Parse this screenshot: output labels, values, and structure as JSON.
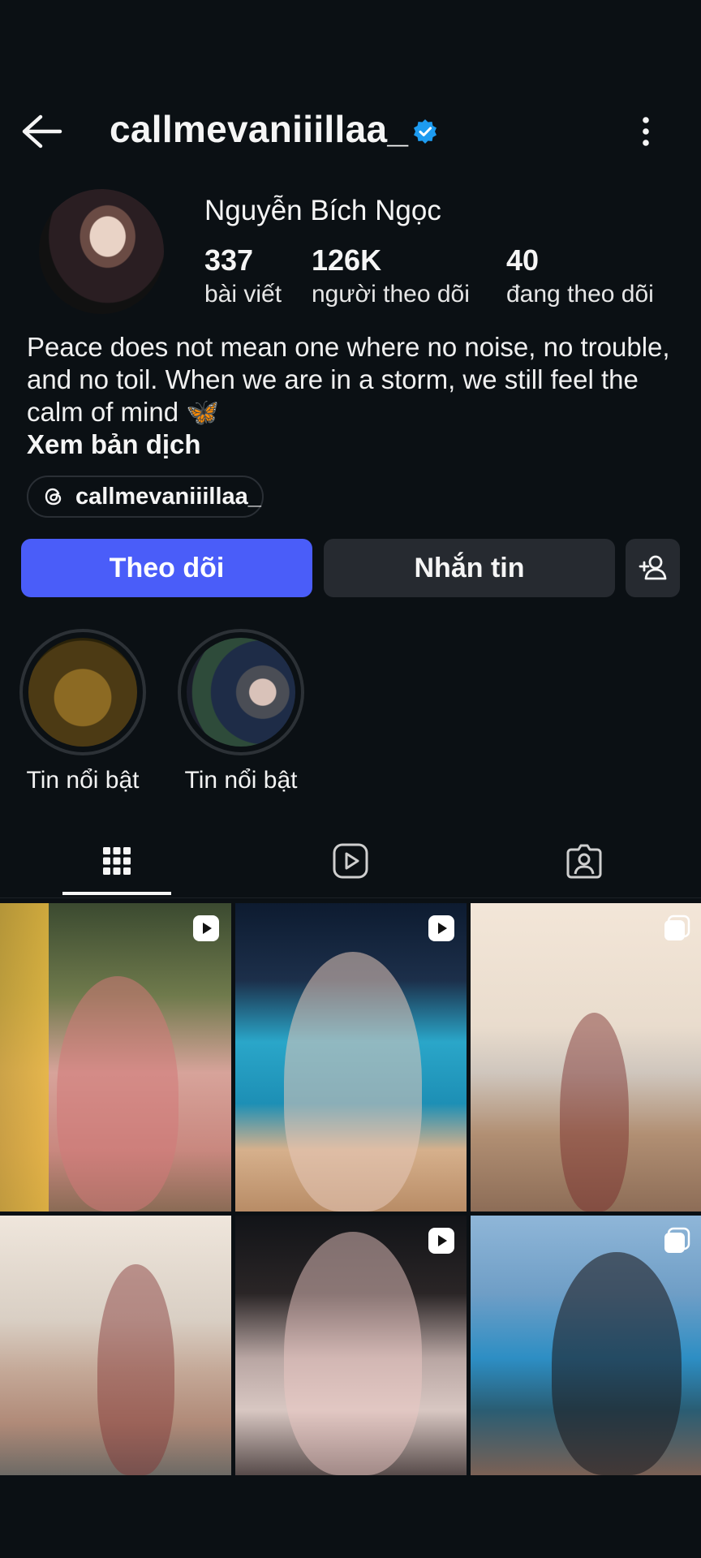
{
  "header": {
    "username": "callmevaniiillaa_",
    "verified": true,
    "back_icon": "arrow-left-icon",
    "more_icon": "more-vertical-icon"
  },
  "profile": {
    "display_name": "Nguyễn Bích Ngọc",
    "stats": [
      {
        "value": "337",
        "label": "bài viết"
      },
      {
        "value": "126K",
        "label": "người theo dõi"
      },
      {
        "value": "40",
        "label": "đang theo dõi"
      }
    ],
    "bio": "Peace does not mean one where no noise, no trouble, and no toil. When we are in a storm, we still feel the calm of mind 🦋",
    "translate_label": "Xem bản dịch",
    "threads_handle": "callmevaniiillaa_"
  },
  "actions": {
    "follow_label": "Theo dõi",
    "message_label": "Nhắn tin",
    "add_user_icon": "add-user-icon"
  },
  "highlights": [
    {
      "label": "Tin nổi bật"
    },
    {
      "label": "Tin nổi bật"
    }
  ],
  "tabs": [
    {
      "icon": "grid-icon",
      "active": true
    },
    {
      "icon": "reels-icon",
      "active": false
    },
    {
      "icon": "tagged-icon",
      "active": false
    }
  ],
  "grid": [
    {
      "type": "reel"
    },
    {
      "type": "reel"
    },
    {
      "type": "carousel"
    },
    {
      "type": "post"
    },
    {
      "type": "reel"
    },
    {
      "type": "carousel"
    }
  ],
  "colors": {
    "background": "#0b1014",
    "accent": "#4a5df9",
    "verified": "#1d9bf0",
    "secondary_button": "#262a30"
  }
}
